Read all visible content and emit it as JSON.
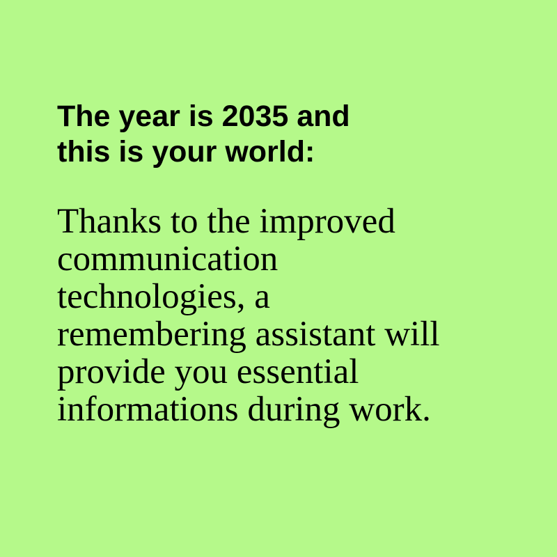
{
  "colors": {
    "background": "#b5f98a",
    "text": "#000000"
  },
  "heading": {
    "lines": [
      "The year is 2035 and",
      "this is your world:"
    ]
  },
  "body": {
    "lines": [
      "Thanks to the improved",
      "communication",
      "technologies, a",
      "remembering assistant will",
      "provide you essential",
      "informations during work."
    ]
  }
}
